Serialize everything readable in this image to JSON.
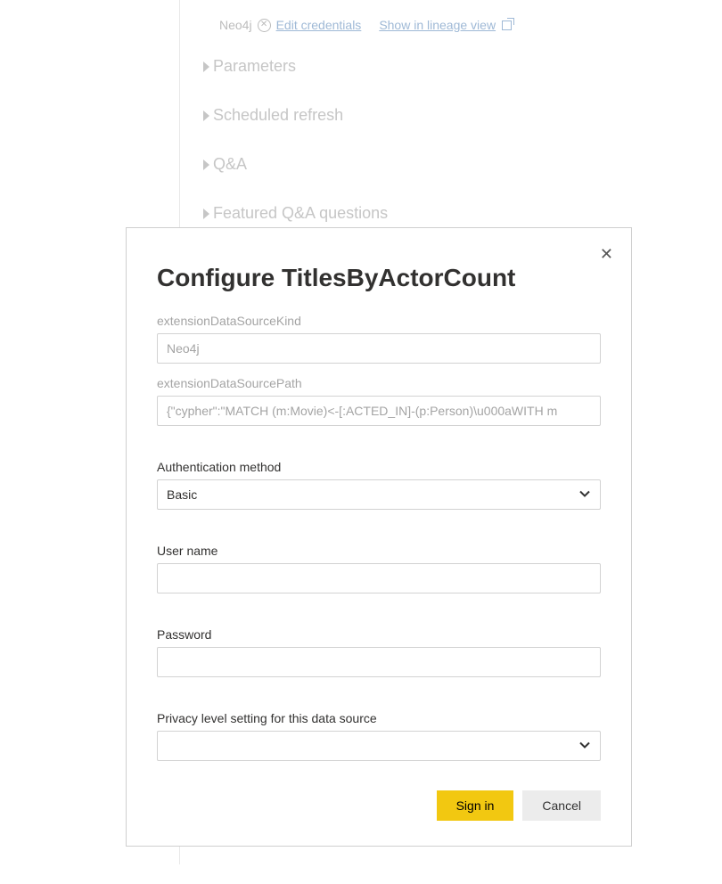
{
  "background": {
    "datasource_label": "Neo4j",
    "edit_credentials": "Edit credentials",
    "lineage_link": "Show in lineage view",
    "collapsed_sections": [
      "Parameters",
      "Scheduled refresh",
      "Q&A",
      "Featured Q&A questions"
    ]
  },
  "dialog": {
    "title": "Configure TitlesByActorCount",
    "fields": {
      "ext_kind": {
        "label": "extensionDataSourceKind",
        "value": "Neo4j"
      },
      "ext_path": {
        "label": "extensionDataSourcePath",
        "value": "{\"cypher\":\"MATCH (m:Movie)<-[:ACTED_IN]-(p:Person)\\u000aWITH m"
      },
      "auth": {
        "label": "Authentication method",
        "value": "Basic"
      },
      "username": {
        "label": "User name",
        "value": ""
      },
      "password": {
        "label": "Password",
        "value": ""
      },
      "privacy": {
        "label": "Privacy level setting for this data source",
        "value": ""
      }
    },
    "actions": {
      "signin": "Sign in",
      "cancel": "Cancel"
    }
  }
}
